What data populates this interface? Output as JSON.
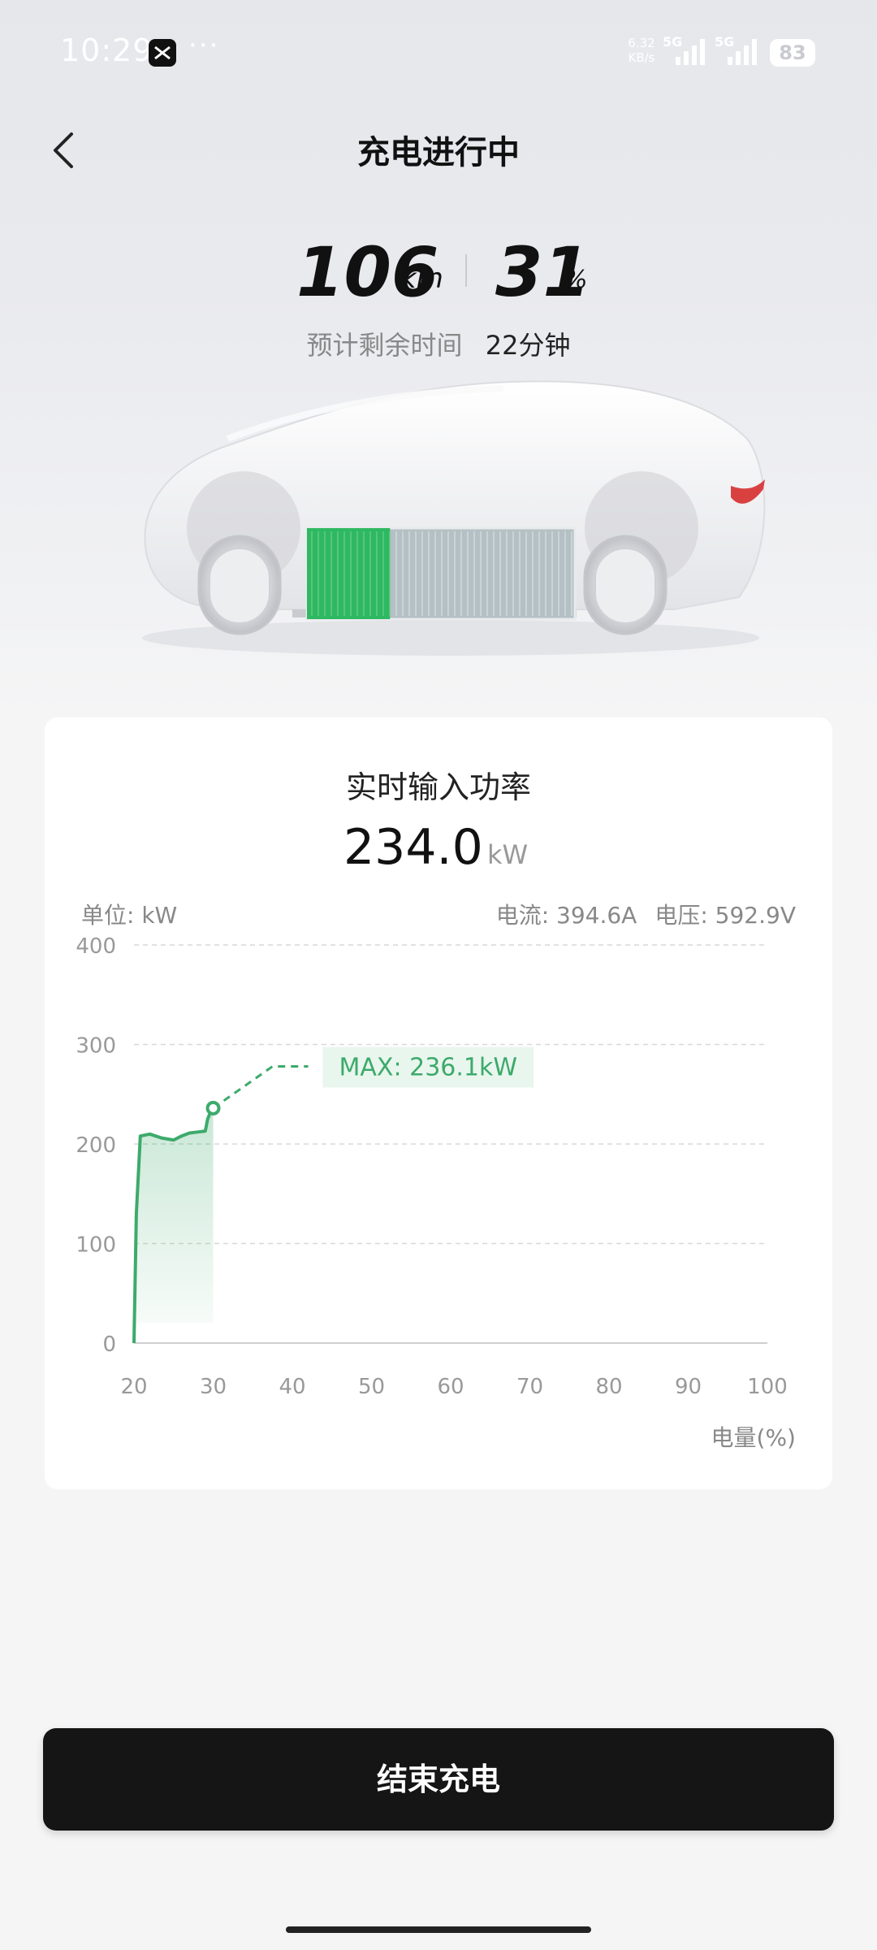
{
  "status_bar": {
    "time": "10:29",
    "net_speed_value": "6.32",
    "net_speed_unit": "KB/s",
    "signal1_label": "5G",
    "signal2_label": "5G",
    "battery": "83"
  },
  "header": {
    "title": "充电进行中"
  },
  "stats": {
    "range_value": "106",
    "range_unit": "km",
    "soc_value": "31",
    "soc_unit": "%",
    "remaining_label": "预计剩余时间",
    "remaining_value": "22分钟"
  },
  "battery_fill_fraction": 0.31,
  "card": {
    "title": "实时输入功率",
    "power_value": "234.0",
    "power_unit": "kW",
    "unit_label": "单位: kW",
    "current": "电流: 394.6A",
    "voltage": "电压: 592.9V",
    "max_label": "MAX: 236.1kW",
    "x_axis_label": "电量(%)"
  },
  "chart_data": {
    "type": "line",
    "xlabel": "电量(%)",
    "ylabel": "单位: kW",
    "xlim": [
      20,
      100
    ],
    "ylim": [
      0,
      400
    ],
    "x_ticks": [
      "20",
      "30",
      "40",
      "50",
      "60",
      "70",
      "80",
      "90",
      "100"
    ],
    "y_ticks": [
      "0",
      "100",
      "200",
      "300",
      "400"
    ],
    "grid": true,
    "series": [
      {
        "x": [
          20,
          20.3,
          20.8,
          22,
          23.5,
          25,
          26,
          27,
          28,
          29,
          29.3,
          29.8,
          30
        ],
        "y": [
          0,
          130,
          208,
          210,
          206,
          204,
          208,
          211,
          212,
          213,
          225,
          235,
          236
        ],
        "color": "#3daa6b"
      }
    ],
    "projection": {
      "x": [
        30,
        37.5,
        42
      ],
      "y": [
        236,
        278,
        278
      ]
    },
    "max_annotation": "MAX: 236.1kW"
  },
  "footer": {
    "end_button": "结束充电"
  }
}
